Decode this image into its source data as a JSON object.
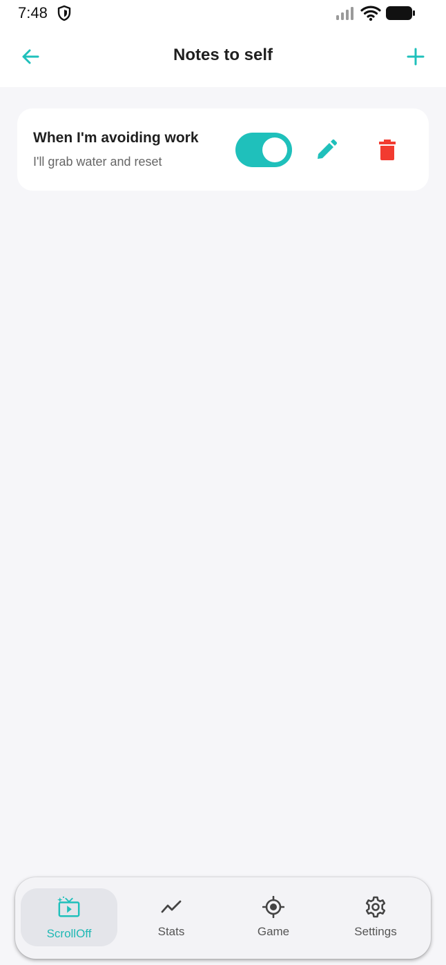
{
  "status_bar": {
    "time": "7:48"
  },
  "app_bar": {
    "title": "Notes to self"
  },
  "notes": [
    {
      "title": "When I'm avoiding work",
      "subtitle": "I'll grab water and reset",
      "enabled": true
    }
  ],
  "bottom_nav": {
    "items": [
      {
        "label": "ScrollOff",
        "icon": "tv-sparkle-icon",
        "active": true
      },
      {
        "label": "Stats",
        "icon": "trend-line-icon",
        "active": false
      },
      {
        "label": "Game",
        "icon": "target-icon",
        "active": false
      },
      {
        "label": "Settings",
        "icon": "gear-icon",
        "active": false
      }
    ]
  },
  "colors": {
    "accent": "#1fc0bb",
    "delete": "#f23b30",
    "background": "#f6f6f9",
    "card": "#ffffff"
  }
}
